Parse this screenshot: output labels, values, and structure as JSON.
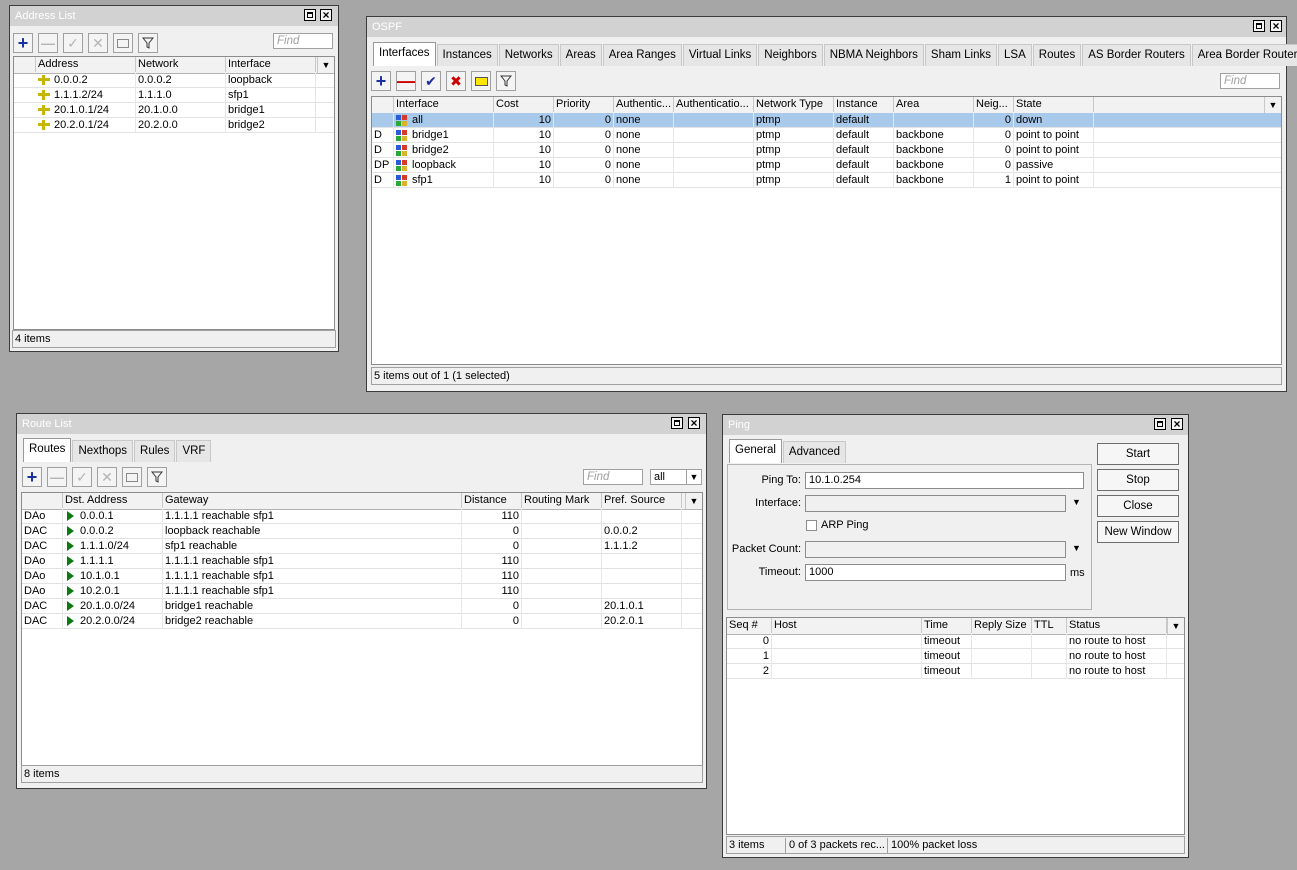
{
  "address_list": {
    "title": "Address List",
    "find": "Find",
    "columns": [
      "Address",
      "Network",
      "Interface"
    ],
    "rows": [
      {
        "address": "0.0.0.2",
        "network": "0.0.0.2",
        "interface": "loopback"
      },
      {
        "address": "1.1.1.2/24",
        "network": "1.1.1.0",
        "interface": "sfp1"
      },
      {
        "address": "20.1.0.1/24",
        "network": "20.1.0.0",
        "interface": "bridge1"
      },
      {
        "address": "20.2.0.1/24",
        "network": "20.2.0.0",
        "interface": "bridge2"
      }
    ],
    "status": "4 items"
  },
  "ospf": {
    "title": "OSPF",
    "tabs": [
      "Interfaces",
      "Instances",
      "Networks",
      "Areas",
      "Area Ranges",
      "Virtual Links",
      "Neighbors",
      "NBMA Neighbors",
      "Sham Links",
      "LSA",
      "Routes",
      "AS Border Routers",
      "Area Border Routers"
    ],
    "find": "Find",
    "columns": [
      "Interface",
      "Cost",
      "Priority",
      "Authentic...",
      "Authenticatio...",
      "Network Type",
      "Instance",
      "Area",
      "Neig...",
      "State"
    ],
    "rows": [
      {
        "flag": "",
        "interface": "all",
        "cost": "10",
        "priority": "0",
        "auth": "none",
        "authkey": "",
        "nettype": "ptmp",
        "instance": "default",
        "area": "",
        "neigh": "0",
        "state": "down"
      },
      {
        "flag": "D",
        "interface": "bridge1",
        "cost": "10",
        "priority": "0",
        "auth": "none",
        "authkey": "",
        "nettype": "ptmp",
        "instance": "default",
        "area": "backbone",
        "neigh": "0",
        "state": "point to point"
      },
      {
        "flag": "D",
        "interface": "bridge2",
        "cost": "10",
        "priority": "0",
        "auth": "none",
        "authkey": "",
        "nettype": "ptmp",
        "instance": "default",
        "area": "backbone",
        "neigh": "0",
        "state": "point to point"
      },
      {
        "flag": "DP",
        "interface": "loopback",
        "cost": "10",
        "priority": "0",
        "auth": "none",
        "authkey": "",
        "nettype": "ptmp",
        "instance": "default",
        "area": "backbone",
        "neigh": "0",
        "state": "passive"
      },
      {
        "flag": "D",
        "interface": "sfp1",
        "cost": "10",
        "priority": "0",
        "auth": "none",
        "authkey": "",
        "nettype": "ptmp",
        "instance": "default",
        "area": "backbone",
        "neigh": "1",
        "state": "point to point"
      }
    ],
    "status": "5 items out of 1 (1 selected)"
  },
  "route_list": {
    "title": "Route List",
    "tabs": [
      "Routes",
      "Nexthops",
      "Rules",
      "VRF"
    ],
    "find": "Find",
    "filter_value": "all",
    "columns": [
      "Dst. Address",
      "Gateway",
      "Distance",
      "Routing Mark",
      "Pref. Source"
    ],
    "rows": [
      {
        "flag": "DAo",
        "dst": "0.0.0.1",
        "gateway": "1.1.1.1 reachable sfp1",
        "distance": "110",
        "mark": "",
        "pref": ""
      },
      {
        "flag": "DAC",
        "dst": "0.0.0.2",
        "gateway": "loopback reachable",
        "distance": "0",
        "mark": "",
        "pref": "0.0.0.2"
      },
      {
        "flag": "DAC",
        "dst": "1.1.1.0/24",
        "gateway": "sfp1 reachable",
        "distance": "0",
        "mark": "",
        "pref": "1.1.1.2"
      },
      {
        "flag": "DAo",
        "dst": "1.1.1.1",
        "gateway": "1.1.1.1 reachable sfp1",
        "distance": "110",
        "mark": "",
        "pref": ""
      },
      {
        "flag": "DAo",
        "dst": "10.1.0.1",
        "gateway": "1.1.1.1 reachable sfp1",
        "distance": "110",
        "mark": "",
        "pref": ""
      },
      {
        "flag": "DAo",
        "dst": "10.2.0.1",
        "gateway": "1.1.1.1 reachable sfp1",
        "distance": "110",
        "mark": "",
        "pref": ""
      },
      {
        "flag": "DAC",
        "dst": "20.1.0.0/24",
        "gateway": "bridge1 reachable",
        "distance": "0",
        "mark": "",
        "pref": "20.1.0.1"
      },
      {
        "flag": "DAC",
        "dst": "20.2.0.0/24",
        "gateway": "bridge2 reachable",
        "distance": "0",
        "mark": "",
        "pref": "20.2.0.1"
      }
    ],
    "status": "8 items"
  },
  "ping": {
    "title": "Ping",
    "tabs": [
      "General",
      "Advanced"
    ],
    "labels": {
      "ping_to": "Ping To:",
      "interface": "Interface:",
      "arp_ping": "ARP Ping",
      "packet_count": "Packet Count:",
      "timeout": "Timeout:",
      "timeout_unit": "ms"
    },
    "values": {
      "ping_to": "10.1.0.254",
      "interface": "",
      "packet_count": "",
      "timeout": "1000"
    },
    "buttons": {
      "start": "Start",
      "stop": "Stop",
      "close": "Close",
      "new_window": "New Window"
    },
    "columns": [
      "Seq #",
      "Host",
      "Time",
      "Reply Size",
      "TTL",
      "Status"
    ],
    "rows": [
      {
        "seq": "0",
        "host": "",
        "time": "timeout",
        "reply": "",
        "ttl": "",
        "status": "no route to host"
      },
      {
        "seq": "1",
        "host": "",
        "time": "timeout",
        "reply": "",
        "ttl": "",
        "status": "no route to host"
      },
      {
        "seq": "2",
        "host": "",
        "time": "timeout",
        "reply": "",
        "ttl": "",
        "status": "no route to host"
      }
    ],
    "status": {
      "items": "3 items",
      "received": "0 of 3 packets rec...",
      "loss": "100% packet loss"
    }
  }
}
